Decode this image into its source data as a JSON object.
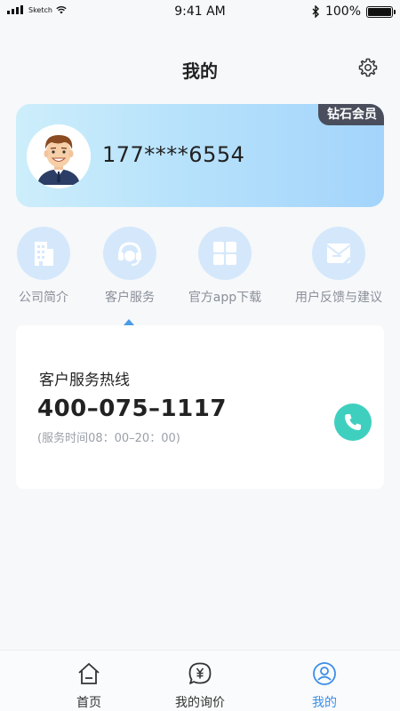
{
  "status_bar": {
    "carrier": "Sketch",
    "time": "9:41 AM",
    "battery": "100%",
    "battery_level": 1.0
  },
  "header": {
    "title": "我的",
    "settings_icon": "gear-icon"
  },
  "member_card": {
    "badge": "钻石会员",
    "phone": "177****6554",
    "avatar_icon": "avatar-man-icon"
  },
  "menu": {
    "items": [
      {
        "label": "公司简介",
        "icon": "building-icon"
      },
      {
        "label": "客户服务",
        "icon": "headset-icon"
      },
      {
        "label": "官方app下载",
        "icon": "app-grid-icon"
      },
      {
        "label": "用户反馈与建议",
        "icon": "feedback-icon"
      }
    ],
    "selected_index": 1
  },
  "service": {
    "title": "客户服务热线",
    "number": "400–075–1117",
    "hours": "(服务时间08：00–20：00)",
    "call_icon": "phone-icon"
  },
  "tab_bar": {
    "tabs": [
      {
        "label": "首页",
        "icon": "home-icon"
      },
      {
        "label": "我的询价",
        "icon": "price-inquiry-icon"
      },
      {
        "label": "我的",
        "icon": "user-profile-icon"
      }
    ],
    "active_index": 2
  },
  "colors": {
    "accent": "#3a8ee6",
    "call_button": "#3fcfbf",
    "badge_bg": "#4a4e5c",
    "menu_icon_bg": "#d5e8fb"
  }
}
